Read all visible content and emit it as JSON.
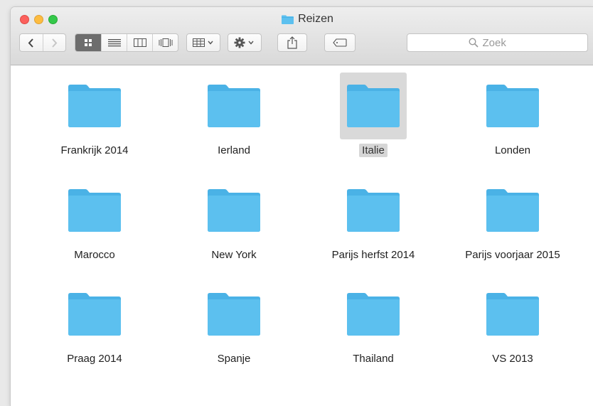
{
  "window": {
    "title": "Reizen"
  },
  "search": {
    "placeholder": "Zoek"
  },
  "folders": [
    {
      "label": "Frankrijk 2014",
      "selected": false
    },
    {
      "label": "Ierland",
      "selected": false
    },
    {
      "label": "Italie",
      "selected": true
    },
    {
      "label": "Londen",
      "selected": false
    },
    {
      "label": "Marocco",
      "selected": false
    },
    {
      "label": "New York",
      "selected": false
    },
    {
      "label": "Parijs herfst 2014",
      "selected": false
    },
    {
      "label": "Parijs voorjaar 2015",
      "selected": false
    },
    {
      "label": "Praag 2014",
      "selected": false
    },
    {
      "label": "Spanje",
      "selected": false
    },
    {
      "label": "Thailand",
      "selected": false
    },
    {
      "label": "VS 2013",
      "selected": false
    }
  ],
  "colors": {
    "folder": "#5cc0ef",
    "folder_tab": "#4ab2e6",
    "selection": "#d9d9d9"
  },
  "icons": {
    "back": "chevron-left-icon",
    "forward": "chevron-right-icon",
    "views": [
      "icon-view-icon",
      "list-view-icon",
      "column-view-icon",
      "cover-flow-icon"
    ],
    "arrange": "arrange-grid-icon",
    "action": "gear-icon",
    "share": "share-icon",
    "tags": "tag-icon",
    "search": "magnifier-icon"
  }
}
